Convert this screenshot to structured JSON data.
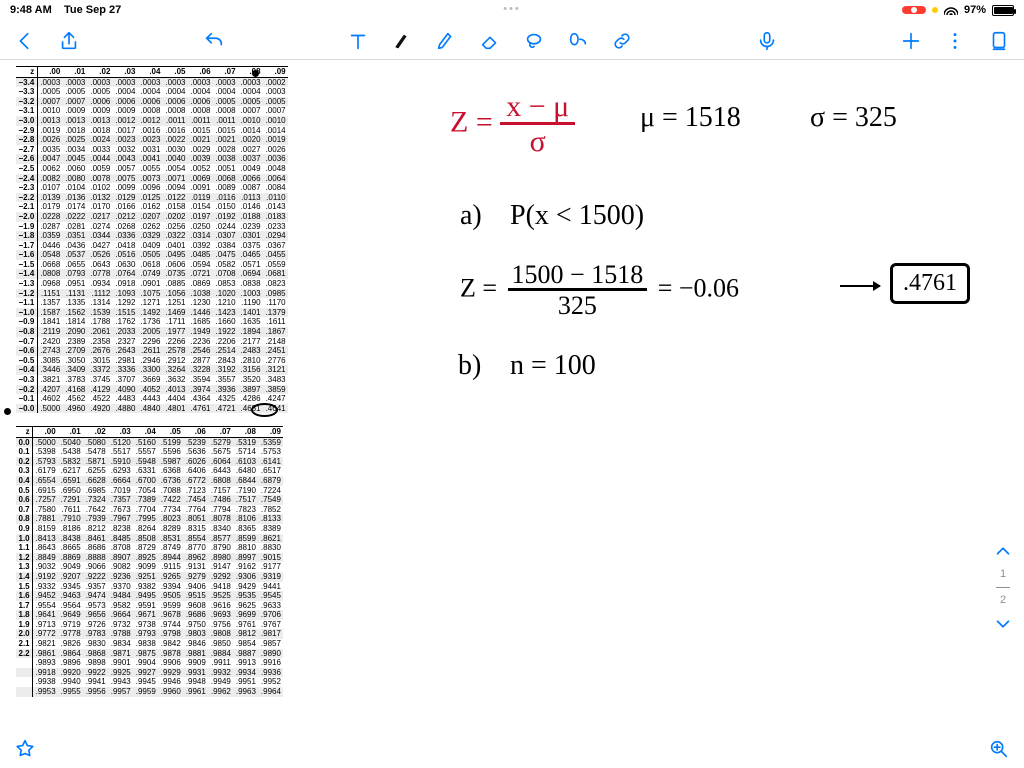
{
  "status": {
    "time": "9:48 AM",
    "date": "Tue Sep 27",
    "battery_pct": "97%"
  },
  "page_indicator": {
    "current": "1",
    "total": "2"
  },
  "handwriting": {
    "formula_lhs": "Z =",
    "formula_num": "x − μ",
    "formula_den": "σ",
    "mu_label": "μ = 1518",
    "sigma_label": "σ = 325",
    "a_label": "a)",
    "a_expr": "P(x < 1500)",
    "z_lhs": "Z =",
    "z_num": "1500 − 1518",
    "z_den": "325",
    "z_val": "= −0.06",
    "z_arrow_target": ".4761",
    "b_label": "b)",
    "b_expr": "n = 100"
  },
  "ztable_neg": {
    "header": [
      "z",
      ".00",
      ".01",
      ".02",
      ".03",
      ".04",
      ".05",
      ".06",
      ".07",
      ".08",
      ".09"
    ],
    "rows": [
      [
        "−3.4",
        ".0003",
        ".0003",
        ".0003",
        ".0003",
        ".0003",
        ".0003",
        ".0003",
        ".0003",
        ".0003",
        ".0002"
      ],
      [
        "−3.3",
        ".0005",
        ".0005",
        ".0005",
        ".0004",
        ".0004",
        ".0004",
        ".0004",
        ".0004",
        ".0004",
        ".0003"
      ],
      [
        "−3.2",
        ".0007",
        ".0007",
        ".0006",
        ".0006",
        ".0006",
        ".0006",
        ".0006",
        ".0005",
        ".0005",
        ".0005"
      ],
      [
        "−3.1",
        ".0010",
        ".0009",
        ".0009",
        ".0009",
        ".0008",
        ".0008",
        ".0008",
        ".0008",
        ".0007",
        ".0007"
      ],
      [
        "−3.0",
        ".0013",
        ".0013",
        ".0013",
        ".0012",
        ".0012",
        ".0011",
        ".0011",
        ".0011",
        ".0010",
        ".0010"
      ],
      [
        "−2.9",
        ".0019",
        ".0018",
        ".0018",
        ".0017",
        ".0016",
        ".0016",
        ".0015",
        ".0015",
        ".0014",
        ".0014"
      ],
      [
        "−2.8",
        ".0026",
        ".0025",
        ".0024",
        ".0023",
        ".0023",
        ".0022",
        ".0021",
        ".0021",
        ".0020",
        ".0019"
      ],
      [
        "−2.7",
        ".0035",
        ".0034",
        ".0033",
        ".0032",
        ".0031",
        ".0030",
        ".0029",
        ".0028",
        ".0027",
        ".0026"
      ],
      [
        "−2.6",
        ".0047",
        ".0045",
        ".0044",
        ".0043",
        ".0041",
        ".0040",
        ".0039",
        ".0038",
        ".0037",
        ".0036"
      ],
      [
        "−2.5",
        ".0062",
        ".0060",
        ".0059",
        ".0057",
        ".0055",
        ".0054",
        ".0052",
        ".0051",
        ".0049",
        ".0048"
      ],
      [
        "−2.4",
        ".0082",
        ".0080",
        ".0078",
        ".0075",
        ".0073",
        ".0071",
        ".0069",
        ".0068",
        ".0066",
        ".0064"
      ],
      [
        "−2.3",
        ".0107",
        ".0104",
        ".0102",
        ".0099",
        ".0096",
        ".0094",
        ".0091",
        ".0089",
        ".0087",
        ".0084"
      ],
      [
        "−2.2",
        ".0139",
        ".0136",
        ".0132",
        ".0129",
        ".0125",
        ".0122",
        ".0119",
        ".0116",
        ".0113",
        ".0110"
      ],
      [
        "−2.1",
        ".0179",
        ".0174",
        ".0170",
        ".0166",
        ".0162",
        ".0158",
        ".0154",
        ".0150",
        ".0146",
        ".0143"
      ],
      [
        "−2.0",
        ".0228",
        ".0222",
        ".0217",
        ".0212",
        ".0207",
        ".0202",
        ".0197",
        ".0192",
        ".0188",
        ".0183"
      ],
      [
        "−1.9",
        ".0287",
        ".0281",
        ".0274",
        ".0268",
        ".0262",
        ".0256",
        ".0250",
        ".0244",
        ".0239",
        ".0233"
      ],
      [
        "−1.8",
        ".0359",
        ".0351",
        ".0344",
        ".0336",
        ".0329",
        ".0322",
        ".0314",
        ".0307",
        ".0301",
        ".0294"
      ],
      [
        "−1.7",
        ".0446",
        ".0436",
        ".0427",
        ".0418",
        ".0409",
        ".0401",
        ".0392",
        ".0384",
        ".0375",
        ".0367"
      ],
      [
        "−1.6",
        ".0548",
        ".0537",
        ".0526",
        ".0516",
        ".0505",
        ".0495",
        ".0485",
        ".0475",
        ".0465",
        ".0455"
      ],
      [
        "−1.5",
        ".0668",
        ".0655",
        ".0643",
        ".0630",
        ".0618",
        ".0606",
        ".0594",
        ".0582",
        ".0571",
        ".0559"
      ],
      [
        "−1.4",
        ".0808",
        ".0793",
        ".0778",
        ".0764",
        ".0749",
        ".0735",
        ".0721",
        ".0708",
        ".0694",
        ".0681"
      ],
      [
        "−1.3",
        ".0968",
        ".0951",
        ".0934",
        ".0918",
        ".0901",
        ".0885",
        ".0869",
        ".0853",
        ".0838",
        ".0823"
      ],
      [
        "−1.2",
        ".1151",
        ".1131",
        ".1112",
        ".1093",
        ".1075",
        ".1056",
        ".1038",
        ".1020",
        ".1003",
        ".0985"
      ],
      [
        "−1.1",
        ".1357",
        ".1335",
        ".1314",
        ".1292",
        ".1271",
        ".1251",
        ".1230",
        ".1210",
        ".1190",
        ".1170"
      ],
      [
        "−1.0",
        ".1587",
        ".1562",
        ".1539",
        ".1515",
        ".1492",
        ".1469",
        ".1446",
        ".1423",
        ".1401",
        ".1379"
      ],
      [
        "−0.9",
        ".1841",
        ".1814",
        ".1788",
        ".1762",
        ".1736",
        ".1711",
        ".1685",
        ".1660",
        ".1635",
        ".1611"
      ],
      [
        "−0.8",
        ".2119",
        ".2090",
        ".2061",
        ".2033",
        ".2005",
        ".1977",
        ".1949",
        ".1922",
        ".1894",
        ".1867"
      ],
      [
        "−0.7",
        ".2420",
        ".2389",
        ".2358",
        ".2327",
        ".2296",
        ".2266",
        ".2236",
        ".2206",
        ".2177",
        ".2148"
      ],
      [
        "−0.6",
        ".2743",
        ".2709",
        ".2676",
        ".2643",
        ".2611",
        ".2578",
        ".2546",
        ".2514",
        ".2483",
        ".2451"
      ],
      [
        "−0.5",
        ".3085",
        ".3050",
        ".3015",
        ".2981",
        ".2946",
        ".2912",
        ".2877",
        ".2843",
        ".2810",
        ".2776"
      ],
      [
        "−0.4",
        ".3446",
        ".3409",
        ".3372",
        ".3336",
        ".3300",
        ".3264",
        ".3228",
        ".3192",
        ".3156",
        ".3121"
      ],
      [
        "−0.3",
        ".3821",
        ".3783",
        ".3745",
        ".3707",
        ".3669",
        ".3632",
        ".3594",
        ".3557",
        ".3520",
        ".3483"
      ],
      [
        "−0.2",
        ".4207",
        ".4168",
        ".4129",
        ".4090",
        ".4052",
        ".4013",
        ".3974",
        ".3936",
        ".3897",
        ".3859"
      ],
      [
        "−0.1",
        ".4602",
        ".4562",
        ".4522",
        ".4483",
        ".4443",
        ".4404",
        ".4364",
        ".4325",
        ".4286",
        ".4247"
      ],
      [
        "−0.0",
        ".5000",
        ".4960",
        ".4920",
        ".4880",
        ".4840",
        ".4801",
        ".4761",
        ".4721",
        ".4681",
        ".4641"
      ]
    ]
  },
  "ztable_pos": {
    "header": [
      "z",
      ".00",
      ".01",
      ".02",
      ".03",
      ".04",
      ".05",
      ".06",
      ".07",
      ".08",
      ".09"
    ],
    "rows": [
      [
        "0.0",
        ".5000",
        ".5040",
        ".5080",
        ".5120",
        ".5160",
        ".5199",
        ".5239",
        ".5279",
        ".5319",
        ".5359"
      ],
      [
        "0.1",
        ".5398",
        ".5438",
        ".5478",
        ".5517",
        ".5557",
        ".5596",
        ".5636",
        ".5675",
        ".5714",
        ".5753"
      ],
      [
        "0.2",
        ".5793",
        ".5832",
        ".5871",
        ".5910",
        ".5948",
        ".5987",
        ".6026",
        ".6064",
        ".6103",
        ".6141"
      ],
      [
        "0.3",
        ".6179",
        ".6217",
        ".6255",
        ".6293",
        ".6331",
        ".6368",
        ".6406",
        ".6443",
        ".6480",
        ".6517"
      ],
      [
        "0.4",
        ".6554",
        ".6591",
        ".6628",
        ".6664",
        ".6700",
        ".6736",
        ".6772",
        ".6808",
        ".6844",
        ".6879"
      ],
      [
        "0.5",
        ".6915",
        ".6950",
        ".6985",
        ".7019",
        ".7054",
        ".7088",
        ".7123",
        ".7157",
        ".7190",
        ".7224"
      ],
      [
        "0.6",
        ".7257",
        ".7291",
        ".7324",
        ".7357",
        ".7389",
        ".7422",
        ".7454",
        ".7486",
        ".7517",
        ".7549"
      ],
      [
        "0.7",
        ".7580",
        ".7611",
        ".7642",
        ".7673",
        ".7704",
        ".7734",
        ".7764",
        ".7794",
        ".7823",
        ".7852"
      ],
      [
        "0.8",
        ".7881",
        ".7910",
        ".7939",
        ".7967",
        ".7995",
        ".8023",
        ".8051",
        ".8078",
        ".8106",
        ".8133"
      ],
      [
        "0.9",
        ".8159",
        ".8186",
        ".8212",
        ".8238",
        ".8264",
        ".8289",
        ".8315",
        ".8340",
        ".8365",
        ".8389"
      ],
      [
        "1.0",
        ".8413",
        ".8438",
        ".8461",
        ".8485",
        ".8508",
        ".8531",
        ".8554",
        ".8577",
        ".8599",
        ".8621"
      ],
      [
        "1.1",
        ".8643",
        ".8665",
        ".8686",
        ".8708",
        ".8729",
        ".8749",
        ".8770",
        ".8790",
        ".8810",
        ".8830"
      ],
      [
        "1.2",
        ".8849",
        ".8869",
        ".8888",
        ".8907",
        ".8925",
        ".8944",
        ".8962",
        ".8980",
        ".8997",
        ".9015"
      ],
      [
        "1.3",
        ".9032",
        ".9049",
        ".9066",
        ".9082",
        ".9099",
        ".9115",
        ".9131",
        ".9147",
        ".9162",
        ".9177"
      ],
      [
        "1.4",
        ".9192",
        ".9207",
        ".9222",
        ".9236",
        ".9251",
        ".9265",
        ".9279",
        ".9292",
        ".9306",
        ".9319"
      ],
      [
        "1.5",
        ".9332",
        ".9345",
        ".9357",
        ".9370",
        ".9382",
        ".9394",
        ".9406",
        ".9418",
        ".9429",
        ".9441"
      ],
      [
        "1.6",
        ".9452",
        ".9463",
        ".9474",
        ".9484",
        ".9495",
        ".9505",
        ".9515",
        ".9525",
        ".9535",
        ".9545"
      ],
      [
        "1.7",
        ".9554",
        ".9564",
        ".9573",
        ".9582",
        ".9591",
        ".9599",
        ".9608",
        ".9616",
        ".9625",
        ".9633"
      ],
      [
        "1.8",
        ".9641",
        ".9649",
        ".9656",
        ".9664",
        ".9671",
        ".9678",
        ".9686",
        ".9693",
        ".9699",
        ".9706"
      ],
      [
        "1.9",
        ".9713",
        ".9719",
        ".9726",
        ".9732",
        ".9738",
        ".9744",
        ".9750",
        ".9756",
        ".9761",
        ".9767"
      ],
      [
        "2.0",
        ".9772",
        ".9778",
        ".9783",
        ".9788",
        ".9793",
        ".9798",
        ".9803",
        ".9808",
        ".9812",
        ".9817"
      ],
      [
        "2.1",
        ".9821",
        ".9826",
        ".9830",
        ".9834",
        ".9838",
        ".9842",
        ".9846",
        ".9850",
        ".9854",
        ".9857"
      ],
      [
        "2.2",
        ".9861",
        ".9864",
        ".9868",
        ".9871",
        ".9875",
        ".9878",
        ".9881",
        ".9884",
        ".9887",
        ".9890"
      ],
      [
        "",
        ".9893",
        ".9896",
        ".9898",
        ".9901",
        ".9904",
        ".9906",
        ".9909",
        ".9911",
        ".9913",
        ".9916"
      ],
      [
        "",
        ".9918",
        ".9920",
        ".9922",
        ".9925",
        ".9927",
        ".9929",
        ".9931",
        ".9932",
        ".9934",
        ".9936"
      ],
      [
        "",
        ".9938",
        ".9940",
        ".9941",
        ".9943",
        ".9945",
        ".9946",
        ".9948",
        ".9949",
        ".9951",
        ".9952"
      ],
      [
        "",
        ".9953",
        ".9955",
        ".9956",
        ".9957",
        ".9959",
        ".9960",
        ".9961",
        ".9962",
        ".9963",
        ".9964"
      ]
    ]
  }
}
